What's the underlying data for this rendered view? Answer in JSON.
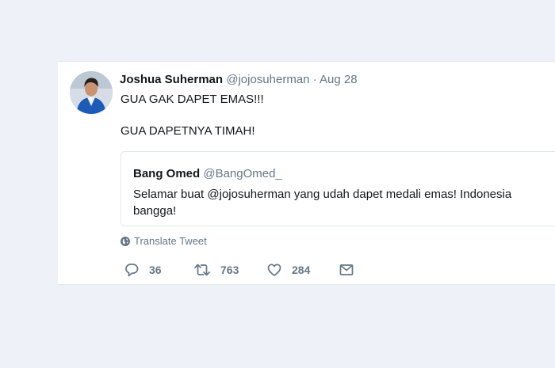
{
  "tweet": {
    "display_name": "Joshua Suherman",
    "handle": "@jojosuherman",
    "separator": "·",
    "date": "Aug 28",
    "lines": [
      "GUA GAK DAPET EMAS!!!",
      "GUA DAPETNYA TIMAH!"
    ]
  },
  "quote": {
    "display_name": "Bang Omed",
    "handle": "@BangOmed_",
    "text": "Selamar buat @jojosuherman yang udah dapet medali emas! Indonesia bangga!"
  },
  "translate_label": "Translate Tweet",
  "actions": {
    "replies": "36",
    "retweets": "763",
    "likes": "284"
  },
  "icons": {
    "reply": "speech-bubble-icon",
    "retweet": "retweet-arrows-icon",
    "like": "heart-icon",
    "message": "envelope-icon",
    "translate": "globe-icon"
  },
  "colors": {
    "background": "#eef1f7",
    "card": "#ffffff",
    "text": "#14171a",
    "muted": "#657786",
    "border": "#e1e8ed"
  }
}
